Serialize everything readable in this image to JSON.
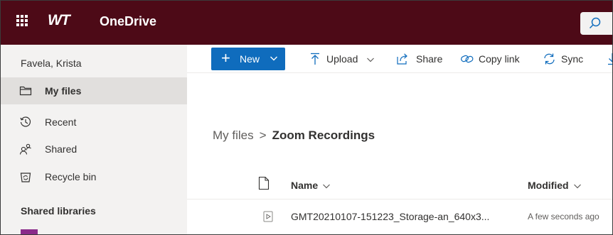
{
  "topbar": {
    "logo": "WT",
    "app_name": "OneDrive",
    "background": "#4d0a17"
  },
  "sidebar": {
    "user_name": "Favela, Krista",
    "items": [
      {
        "label": "My files",
        "icon": "folder-icon",
        "active": true
      },
      {
        "label": "Recent",
        "icon": "history-icon",
        "active": false
      },
      {
        "label": "Shared",
        "icon": "people-icon",
        "active": false
      },
      {
        "label": "Recycle bin",
        "icon": "recycle-bin-icon",
        "active": false
      }
    ],
    "section_header": "Shared libraries"
  },
  "toolbar": {
    "new_label": "New",
    "upload_label": "Upload",
    "share_label": "Share",
    "copy_link_label": "Copy link",
    "sync_label": "Sync",
    "accent": "#0f6cbd"
  },
  "breadcrumb": {
    "root": "My files",
    "separator": ">",
    "current": "Zoom Recordings"
  },
  "file_list": {
    "columns": {
      "name": "Name",
      "modified": "Modified"
    },
    "rows": [
      {
        "name": "GMT20210107-151223_Storage-an_640x3...",
        "modified": "A few seconds ago",
        "icon": "video-file-icon"
      }
    ]
  }
}
